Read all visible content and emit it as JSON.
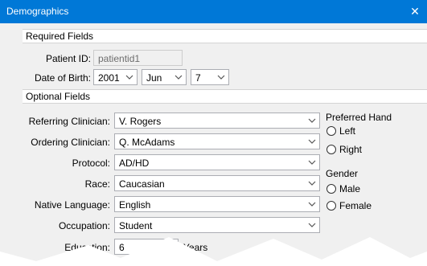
{
  "window": {
    "title": "Demographics",
    "close_glyph": "✕"
  },
  "required": {
    "header": "Required Fields",
    "patient_id_label": "Patient ID:",
    "patient_id_value": "patientid1",
    "dob_label": "Date of Birth:",
    "dob_year": "2001",
    "dob_month": "Jun",
    "dob_day": "7"
  },
  "optional": {
    "header": "Optional Fields",
    "referring_label": "Referring Clinician:",
    "referring_value": "V. Rogers",
    "ordering_label": "Ordering Clinician:",
    "ordering_value": "Q. McAdams",
    "protocol_label": "Protocol:",
    "protocol_value": "AD/HD",
    "race_label": "Race:",
    "race_value": "Caucasian",
    "language_label": "Native Language:",
    "language_value": "English",
    "occupation_label": "Occupation:",
    "occupation_value": "Student",
    "education_label": "Education:",
    "education_value": "6",
    "education_unit": "Years",
    "preferred_hand_label": "Preferred Hand",
    "hand_left": "Left",
    "hand_right": "Right",
    "gender_label": "Gender",
    "gender_male": "Male",
    "gender_female": "Female"
  },
  "icons": {
    "close": "close-icon",
    "chevron": "chevron-down-icon"
  }
}
